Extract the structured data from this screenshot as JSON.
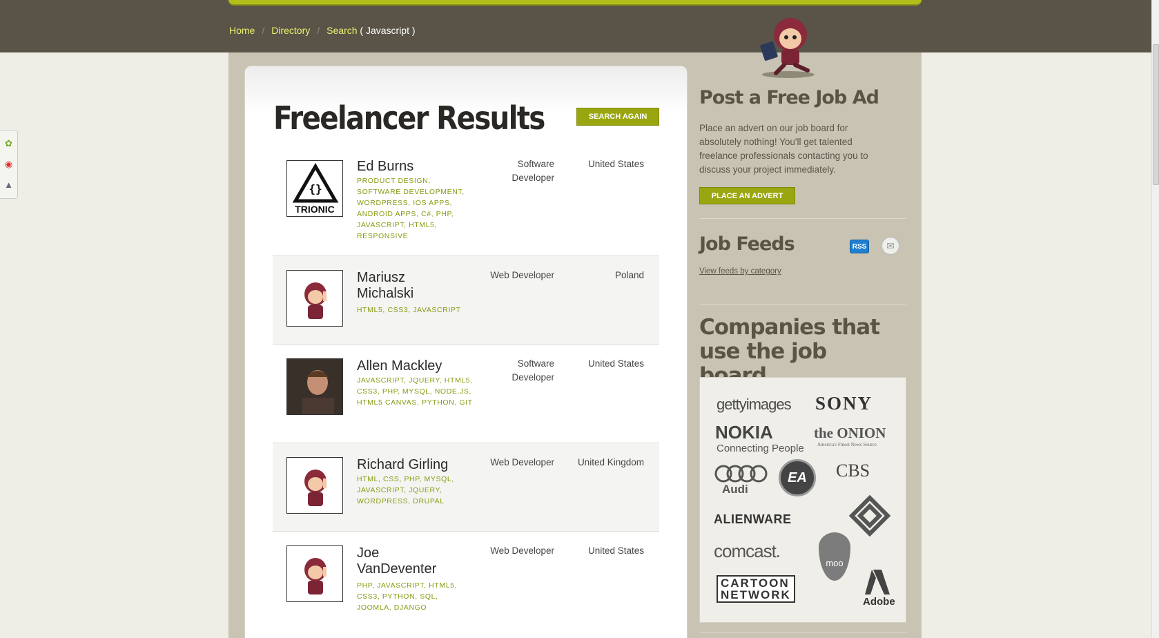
{
  "breadcrumb": {
    "home": "Home",
    "directory": "Directory",
    "search": "Search",
    "query": "( Javascript )",
    "separator": "/"
  },
  "main": {
    "title": "Freelancer Results",
    "search_again_label": "SEARCH AGAIN"
  },
  "freelancers": [
    {
      "name": "Ed Burns",
      "tags": "PRODUCT DESIGN, SOFTWARE DEVELOPMENT, WORDPRESS, IOS APPS, ANDROID APPS, C#, PHP, JAVASCRIPT, HTML5, RESPONSIVE",
      "role": "Software Developer",
      "country": "United States",
      "avatar": "trionic-logo",
      "avatar_text": "TRIONIC"
    },
    {
      "name": "Mariusz Michalski",
      "tags": "HTML5, CSS3, JAVASCRIPT",
      "role": "Web Developer",
      "country": "Poland",
      "avatar": "mascot-placeholder"
    },
    {
      "name": "Allen Mackley",
      "tags": "JAVASCRIPT, JQUERY, HTML5, CSS3, PHP, MYSQL, NODE.JS, HTML5 CANVAS, PYTHON, GIT",
      "role": "Software Developer",
      "country": "United States",
      "avatar": "photo"
    },
    {
      "name": "Richard Girling",
      "tags": "HTML, CSS, PHP, MYSQL, JAVASCRIPT, JQUERY, WORDPRESS, DRUPAL",
      "role": "Web Developer",
      "country": "United Kingdom",
      "avatar": "mascot-placeholder"
    },
    {
      "name": "Joe VanDeventer",
      "tags": "PHP, JAVASCRIPT, HTML5, CSS3, PYTHON, SQL, JOOMLA, DJANGO",
      "role": "Web Developer",
      "country": "United States",
      "avatar": "mascot-placeholder"
    }
  ],
  "sidebar": {
    "post_title": "Post a Free Job Ad",
    "post_text": "Place an advert on our job board for absolutely nothing! You'll get talented freelance professionals contacting you to discuss your project immediately.",
    "place_advert_label": "PLACE AN ADVERT",
    "feeds_title": "Job Feeds",
    "rss_label": "RSS",
    "view_feeds_label": "View feeds by category",
    "companies_title": "Companies that use the job board",
    "companies": {
      "getty": "gettyimages",
      "sony": "SONY",
      "nokia": "NOKIA",
      "nokia_tag": "Connecting People",
      "onion": "the ONION",
      "onion_tag": "America's Finest News Source",
      "audi": "Audi",
      "ea": "EA",
      "cbs": "CBS",
      "alienware": "ALIENWARE",
      "comcast": "comcast.",
      "moo": "moo",
      "cartoon1": "CARTOON",
      "cartoon2": "NETWORK",
      "adobe": "Adobe"
    }
  },
  "colors": {
    "accent": "#9aa60f",
    "header": "#595447",
    "sidebar_bg": "#c8c3b3",
    "tag_color": "#8a9a12"
  }
}
